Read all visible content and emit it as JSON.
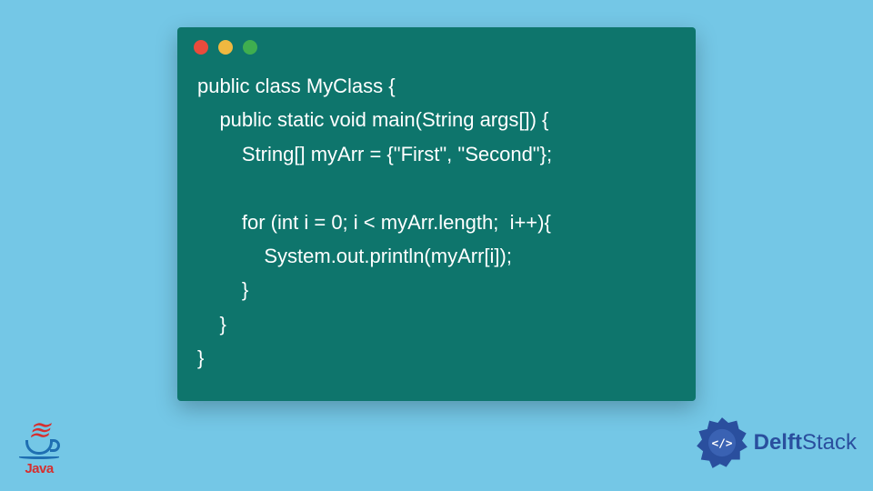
{
  "code_window": {
    "lines": [
      "public class MyClass {",
      "    public static void main(String args[]) {",
      "        String[] myArr = {\"First\", \"Second\"};",
      "",
      "        for (int i = 0; i < myArr.length;  i++){",
      "            System.out.println(myArr[i]);",
      "        }",
      "    }",
      "}"
    ],
    "dot_colors": {
      "red": "#e94b3c",
      "yellow": "#f0b840",
      "green": "#3fae4f"
    },
    "window_bg": "#0e756c"
  },
  "java_logo": {
    "label": "Java"
  },
  "delft_logo": {
    "brand_bold": "Delft",
    "brand_rest": "Stack",
    "badge_glyph": "</>"
  },
  "page_bg": "#74c7e6"
}
